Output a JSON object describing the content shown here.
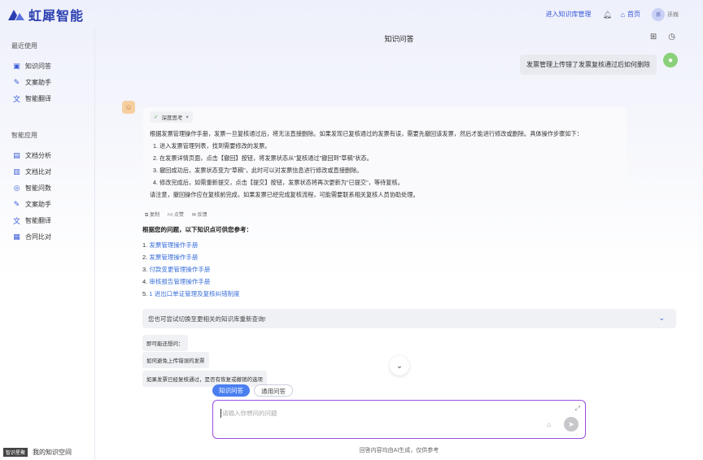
{
  "brand": {
    "name": "虹犀智能",
    "color": "#2b3fb0"
  },
  "header": {
    "kb_link": "进入知识库管理",
    "home_label": "首页",
    "avatar_initial": "孫",
    "user_name": "孫巍"
  },
  "sidebar": {
    "recent_title": "最近使用",
    "recent_items": [
      {
        "label": "知识问答",
        "icon": "book-icon"
      },
      {
        "label": "文案助手",
        "icon": "wand-icon"
      },
      {
        "label": "智能翻译",
        "icon": "translate-icon"
      }
    ],
    "apps_title": "智能应用",
    "app_items": [
      {
        "label": "文档分析",
        "icon": "document-icon"
      },
      {
        "label": "文档比对",
        "icon": "compare-icon"
      },
      {
        "label": "智能问数",
        "icon": "data-icon"
      },
      {
        "label": "文案助手",
        "icon": "wand-icon"
      },
      {
        "label": "智能翻译",
        "icon": "translate-icon"
      },
      {
        "label": "合同比对",
        "icon": "contract-icon"
      }
    ],
    "bottom_badge": "智识星聚",
    "bottom_label": "我的知识空间"
  },
  "chat": {
    "title": "知识问答",
    "user_message": "发票管理上传错了发票复核通过后如何删除",
    "think_label": "深度思考",
    "answer_intro": "根据发票管理操作手册，发票一旦复核通过后，将无法直接删除。如果发现已复核通过的发票有误，需要先撤回该发票，然后才能进行修改或删除。具体操作步骤如下：",
    "answer_steps": [
      "1.  进入发票管理列表，找到需要修改的发票。",
      "2.  在发票详情页面，点击【撤回】按钮，将发票状态从\"复核通过\"撤回到\"草稿\"状态。",
      "3.  撤回成功后，发票状态变为\"草稿\"，此时可以对发票信息进行修改或直接删除。",
      "4.  修改完成后，如需重新提交，点击【提交】按钮，发票状态将再次更新为\"已提交\"，等待复核。"
    ],
    "answer_note": "请注意，撤回操作应在复核前完成，如果发票已经完成复核流程，可能需要联系相关复核人员协助处理。",
    "actions": [
      "复制",
      "点赞",
      "反馈"
    ],
    "ref_title": "根据您的问题，以下知识点可供您参考：",
    "refs": [
      {
        "num": "1.",
        "text": "发票管理操作手册"
      },
      {
        "num": "2.",
        "text": "发票管理操作手册"
      },
      {
        "num": "3.",
        "text": "付款变更管理操作手册"
      },
      {
        "num": "4.",
        "text": "审核报告管理操作手册"
      },
      {
        "num": "5.",
        "text": "1 进出口单证管理及复核纠错制度"
      }
    ],
    "switch_hint": "您也可尝试切换至更相关的知识库重新查询!",
    "suggestions": [
      "即可能还想问：",
      "如何避免上传错误的发票",
      "如果发票已经复核通过，是否有恢复或撤销的选项"
    ],
    "mode_tabs": [
      {
        "label": "知识问答",
        "active": true
      },
      {
        "label": "通用问答",
        "active": false
      }
    ],
    "input_placeholder": "请输入你想问的问题",
    "disclaimer": "回答内容均由AI生成，仅供参考"
  },
  "colors": {
    "accent": "#3a5bd9",
    "input_border": "#9b4de0",
    "active_tab": "#4a7ff0"
  }
}
